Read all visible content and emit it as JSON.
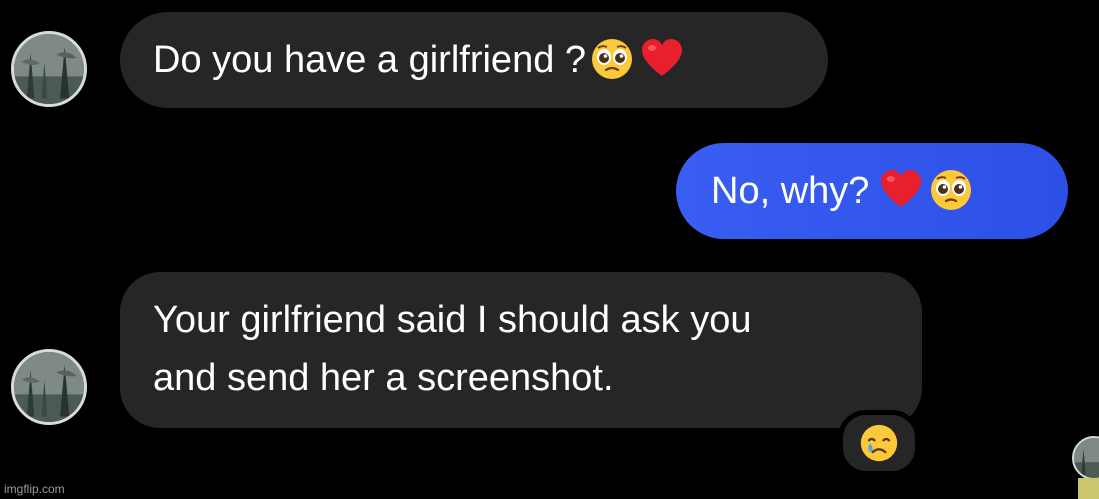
{
  "conversation": {
    "messages": [
      {
        "sender": "other",
        "text": "Do you have a girlfriend ?"
      },
      {
        "sender": "me",
        "text": "No, why?"
      },
      {
        "sender": "other",
        "line1": "Your girlfriend said I should ask you",
        "line2": "and send her a screenshot."
      }
    ],
    "reaction": "crying-face-icon"
  },
  "colors": {
    "background": "#000000",
    "incoming_bubble": "#262626",
    "outgoing_bubble": "#2f54eb",
    "text": "#ffffff"
  },
  "watermark": "imgflip.com"
}
